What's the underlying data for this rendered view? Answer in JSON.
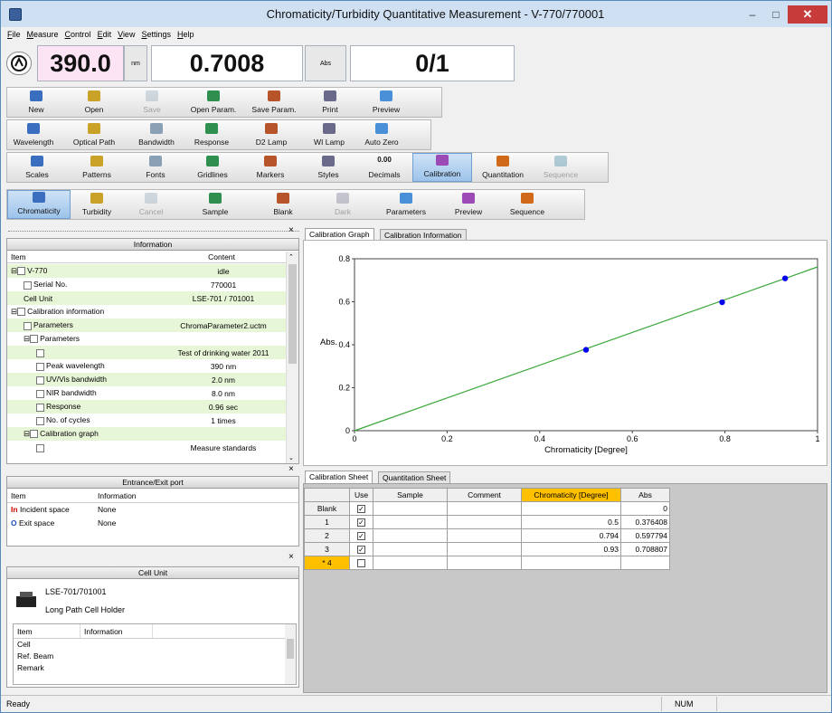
{
  "window": {
    "title": "Chromaticity/Turbidity Quantitative Measurement - V-770/770001",
    "min": "–",
    "max": "□",
    "close": "✕"
  },
  "menu": [
    "File",
    "Measure",
    "Control",
    "Edit",
    "View",
    "Settings",
    "Help"
  ],
  "readout": {
    "wavelength": "390.0",
    "wl_unit": "nm",
    "abs_value": "0.7008",
    "abs_unit": "Abs",
    "count": "0/1"
  },
  "toolbar1": [
    {
      "label": "New",
      "icon": "new-file-icon",
      "disabled": false
    },
    {
      "label": "Open",
      "icon": "open-folder-icon",
      "disabled": false
    },
    {
      "label": "Save",
      "icon": "save-disk-icon",
      "disabled": true
    },
    {
      "label": "Open Param.",
      "icon": "open-param-icon",
      "disabled": false
    },
    {
      "label": "Save Param.",
      "icon": "save-param-icon",
      "disabled": false
    },
    {
      "label": "Print",
      "icon": "printer-icon",
      "disabled": false
    },
    {
      "label": "Preview",
      "icon": "print-preview-icon",
      "disabled": false
    }
  ],
  "toolbar2": [
    {
      "label": "Wavelength",
      "icon": "wavelength-icon"
    },
    {
      "label": "Optical Path",
      "icon": "optical-path-icon"
    },
    {
      "label": "Bandwidth",
      "icon": "bandwidth-icon"
    },
    {
      "label": "Response",
      "icon": "response-icon"
    },
    {
      "label": "D2 Lamp",
      "icon": "d2-lamp-icon"
    },
    {
      "label": "WI Lamp",
      "icon": "wi-lamp-icon"
    },
    {
      "label": "Auto Zero",
      "icon": "auto-zero-icon"
    }
  ],
  "toolbar3": [
    {
      "label": "Scales",
      "icon": "scales-icon",
      "disabled": false,
      "active": false
    },
    {
      "label": "Patterns",
      "icon": "patterns-icon",
      "disabled": false,
      "active": false
    },
    {
      "label": "Fonts",
      "icon": "fonts-icon",
      "disabled": false,
      "active": false
    },
    {
      "label": "Gridlines",
      "icon": "gridlines-icon",
      "disabled": false,
      "active": false
    },
    {
      "label": "Markers",
      "icon": "markers-icon",
      "disabled": false,
      "active": false
    },
    {
      "label": "Styles",
      "icon": "styles-icon",
      "disabled": false,
      "active": false
    },
    {
      "label": "Decimals",
      "icon": "decimals-icon",
      "icon_text": "0.00",
      "disabled": false,
      "active": false
    },
    {
      "label": "Calibration",
      "icon": "calibration-icon",
      "disabled": false,
      "active": true
    },
    {
      "label": "Quantitation",
      "icon": "quantitation-icon",
      "disabled": false,
      "active": false
    },
    {
      "label": "Sequence",
      "icon": "sequence-icon",
      "disabled": true,
      "active": false
    }
  ],
  "toolbar4": [
    {
      "label": "Chromaticity",
      "icon": "chromaticity-icon",
      "disabled": false,
      "active": true
    },
    {
      "label": "Turbidity",
      "icon": "turbidity-icon",
      "disabled": false,
      "active": false
    },
    {
      "label": "Cancel",
      "icon": "stop-icon",
      "disabled": true,
      "active": false
    },
    {
      "label": "Sample",
      "icon": "sample-icon",
      "disabled": false,
      "active": false
    },
    {
      "label": "Blank",
      "icon": "blank-icon",
      "disabled": false,
      "active": false
    },
    {
      "label": "Dark",
      "icon": "dark-icon",
      "disabled": true,
      "active": false
    },
    {
      "label": "Parameters",
      "icon": "parameters-icon",
      "disabled": false,
      "active": false
    },
    {
      "label": "Preview",
      "icon": "preview-icon",
      "disabled": false,
      "active": false
    },
    {
      "label": "Sequence",
      "icon": "sequence-run-icon",
      "disabled": false,
      "active": false
    }
  ],
  "info_panel": {
    "title": "Information",
    "col_item": "Item",
    "col_content": "Content",
    "rows": [
      {
        "item": "V-770",
        "content": "idle",
        "depth": 0,
        "expander": "⊟",
        "icon": "instrument-icon",
        "highlight": true
      },
      {
        "item": "Serial No.",
        "content": "770001",
        "depth": 1,
        "expander": "",
        "icon": "serial-icon",
        "highlight": false
      },
      {
        "item": "Cell Unit",
        "content": "LSE-701 / 701001",
        "depth": 1,
        "expander": "",
        "icon": "",
        "highlight": true
      },
      {
        "item": "Calibration information",
        "content": "",
        "depth": 0,
        "expander": "⊟",
        "icon": "calibration-info-icon",
        "highlight": false
      },
      {
        "item": "Parameters",
        "content": "ChromaParameter2.uctm",
        "depth": 1,
        "expander": "",
        "icon": "param-file-icon",
        "highlight": true
      },
      {
        "item": "Parameters",
        "content": "",
        "depth": 1,
        "expander": "⊟",
        "icon": "param-table-icon",
        "highlight": false
      },
      {
        "item": "",
        "content": "Test of drinking water 2011",
        "depth": 2,
        "expander": "",
        "icon": "doc-icon",
        "highlight": true
      },
      {
        "item": "Peak wavelength",
        "content": "390 nm",
        "depth": 2,
        "expander": "",
        "icon": "doc-icon",
        "highlight": false
      },
      {
        "item": "UV/Vis bandwidth",
        "content": "2.0 nm",
        "depth": 2,
        "expander": "",
        "icon": "doc-icon",
        "highlight": true
      },
      {
        "item": "NIR bandwidth",
        "content": "8.0 nm",
        "depth": 2,
        "expander": "",
        "icon": "doc-icon",
        "highlight": false
      },
      {
        "item": "Response",
        "content": "0.96 sec",
        "depth": 2,
        "expander": "",
        "icon": "doc-icon",
        "highlight": true
      },
      {
        "item": "No. of cycles",
        "content": "1 times",
        "depth": 2,
        "expander": "",
        "icon": "doc-icon",
        "highlight": false
      },
      {
        "item": "Calibration graph",
        "content": "",
        "depth": 1,
        "expander": "⊟",
        "icon": "graph-table-icon",
        "highlight": true
      },
      {
        "item": "",
        "content": "Measure standards",
        "depth": 2,
        "expander": "",
        "icon": "doc-icon",
        "highlight": false
      }
    ]
  },
  "port_panel": {
    "title": "Entrance/Exit port",
    "col_item": "Item",
    "col_info": "Information",
    "rows": [
      {
        "item": "Incident space",
        "info": "None",
        "icon": "incident-icon"
      },
      {
        "item": "Exit space",
        "info": "None",
        "icon": "exit-icon"
      }
    ]
  },
  "cell_panel": {
    "title": "Cell Unit",
    "model": "LSE-701/701001",
    "name": "Long Path Cell Holder",
    "col_item": "Item",
    "col_info": "Information",
    "rows": [
      "Cell",
      "Ref. Beam",
      "Remark"
    ]
  },
  "graph_tabs": [
    "Calibration Graph",
    "Calibration Information"
  ],
  "sheet_tabs": [
    "Calibration Sheet",
    "Quantitation Sheet"
  ],
  "sheet": {
    "headers": [
      "Use",
      "Sample",
      "Comment",
      "Chromaticity [Degree]",
      "Abs"
    ],
    "rows": [
      {
        "label": "Blank",
        "use": true,
        "sample": "",
        "comment": "",
        "chrom": "",
        "abs": "0"
      },
      {
        "label": "1",
        "use": true,
        "sample": "",
        "comment": "",
        "chrom": "0.5",
        "abs": "0.376408"
      },
      {
        "label": "2",
        "use": true,
        "sample": "",
        "comment": "",
        "chrom": "0.794",
        "abs": "0.597794"
      },
      {
        "label": "3",
        "use": true,
        "sample": "",
        "comment": "",
        "chrom": "0.93",
        "abs": "0.708807"
      },
      {
        "label": "* 4",
        "use": false,
        "sample": "",
        "comment": "",
        "chrom": "",
        "abs": ""
      }
    ]
  },
  "chart_data": {
    "type": "scatter",
    "xlabel": "Chromaticity [Degree]",
    "ylabel": "Abs.",
    "xlim": [
      0,
      1
    ],
    "ylim": [
      0,
      0.8
    ],
    "xticks": [
      "0",
      "0.2",
      "0.4",
      "0.6",
      "0.8",
      "1"
    ],
    "yticks": [
      "0",
      "0.2",
      "0.4",
      "0.6",
      "0.8"
    ],
    "x": [
      0.5,
      0.794,
      0.93
    ],
    "y": [
      0.376408,
      0.597794,
      0.708807
    ],
    "fit_line": {
      "x": [
        0,
        1
      ],
      "y": [
        0,
        0.7621
      ]
    },
    "point_color": "#0000ee",
    "line_color": "#3aa83a"
  },
  "status": {
    "left": "Ready",
    "num": "NUM"
  },
  "colors": {
    "highlight_row": "#e8f6d8",
    "selected_header": "#ffc000",
    "wavelength_box": "#fce4f4"
  }
}
